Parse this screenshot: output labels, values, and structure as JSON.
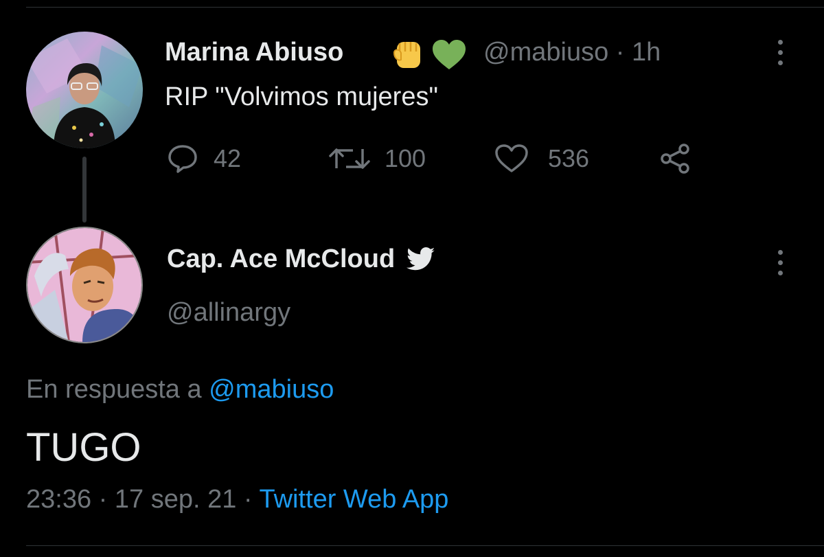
{
  "tweet1": {
    "author_name": "Marina Abiuso",
    "emojis": [
      "raised-fist-icon",
      "green-heart-icon"
    ],
    "handle": "@mabiuso",
    "separator": "·",
    "time": "1h",
    "text": "RIP \"Volvimos mujeres\"",
    "actions": {
      "reply_count": "42",
      "retweet_count": "100",
      "like_count": "536",
      "share_icon": "share-icon"
    }
  },
  "tweet2": {
    "author_name": "Cap. Ace McCloud",
    "badge_icon": "twitter-bird-icon",
    "handle": "@allinargy",
    "reply_prefix": "En respuesta a",
    "reply_to": "@mabiuso",
    "text": "TUGO",
    "time": "23:36",
    "sep1": "·",
    "date": "17 sep. 21",
    "sep2": "·",
    "source": "Twitter Web App"
  },
  "colors": {
    "background": "#000000",
    "text": "#e7e9ea",
    "muted": "#71767b",
    "link": "#1d9bf0",
    "divider": "#2f3336"
  }
}
